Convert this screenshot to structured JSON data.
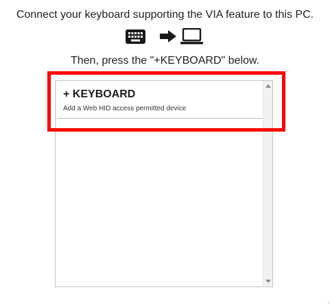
{
  "instructions": {
    "connect": "Connect your keyboard supporting the VIA feature to this PC.",
    "press": "Then, press the \"+KEYBOARD\" below."
  },
  "icons": {
    "keyboard": "keyboard-icon",
    "arrow": "arrow-right-icon",
    "laptop": "laptop-icon"
  },
  "device_list": {
    "add_keyboard": {
      "label": "+ KEYBOARD",
      "description": "Add a Web HID access permitted device"
    }
  },
  "colors": {
    "highlight": "#ff0000",
    "icon": "#1a1a1a",
    "border": "#c4c4c4"
  }
}
